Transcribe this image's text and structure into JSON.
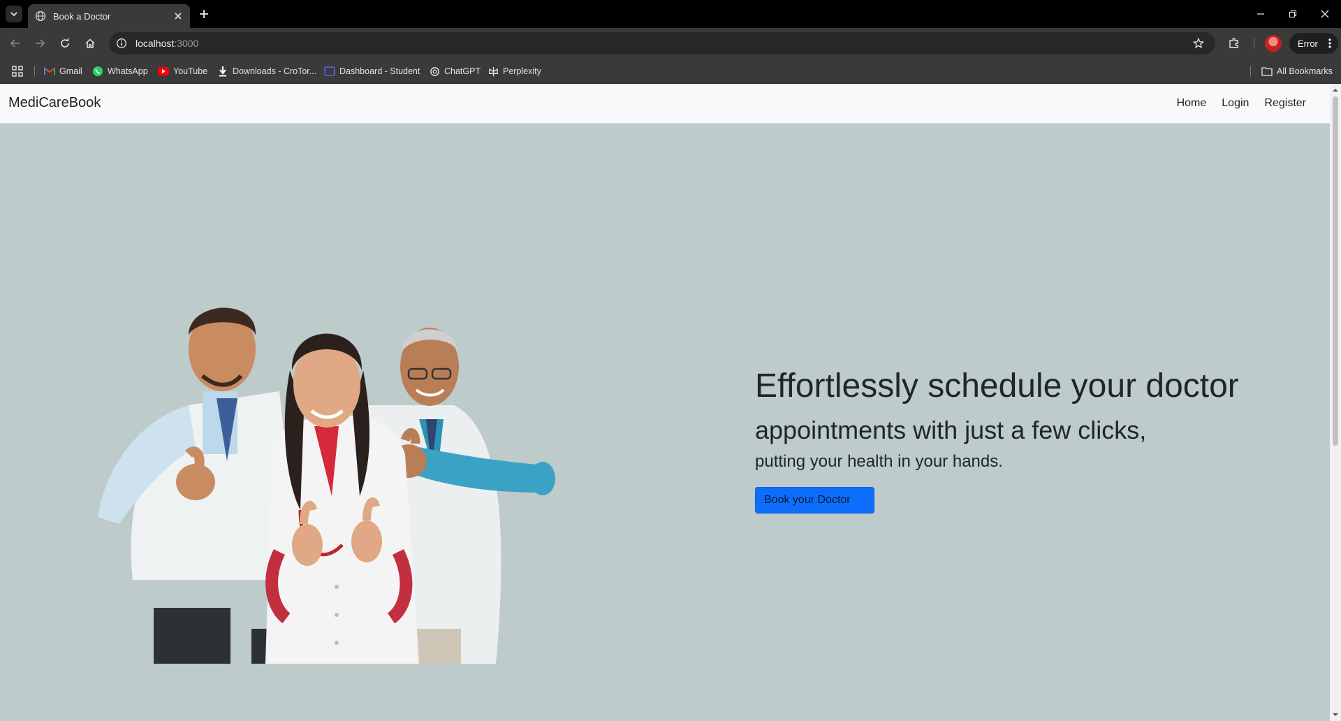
{
  "browser": {
    "tab_title": "Book a Doctor",
    "url_host": "localhost",
    "url_port": ":3000",
    "profile_status": "Error",
    "bookmarks": [
      {
        "label": "Gmail",
        "icon": "gmail-icon",
        "color": "#ea4335"
      },
      {
        "label": "WhatsApp",
        "icon": "whatsapp-icon",
        "color": "#25d366"
      },
      {
        "label": "YouTube",
        "icon": "youtube-icon",
        "color": "#ff0000"
      },
      {
        "label": "Downloads - CroTor...",
        "icon": "download-icon",
        "color": "#ffffff"
      },
      {
        "label": "Dashboard - Student",
        "icon": "dashboard-icon",
        "color": "#4f6bed"
      },
      {
        "label": "ChatGPT",
        "icon": "chatgpt-icon",
        "color": "#ffffff"
      },
      {
        "label": "Perplexity",
        "icon": "perplexity-icon",
        "color": "#ffffff"
      }
    ],
    "all_bookmarks": "All Bookmarks"
  },
  "navbar": {
    "brand": "MediCareBook",
    "links": [
      "Home",
      "Login",
      "Register"
    ]
  },
  "hero": {
    "heading": "Effortlessly schedule your doctor",
    "subheading": "appointments with just a few clicks,",
    "tagline": "putting your health in your hands.",
    "cta_label": "Book your Doctor"
  },
  "colors": {
    "page_bg": "#bdcbca",
    "navbar_bg": "#f8f9fa",
    "cta_bg": "#0d6efd"
  }
}
